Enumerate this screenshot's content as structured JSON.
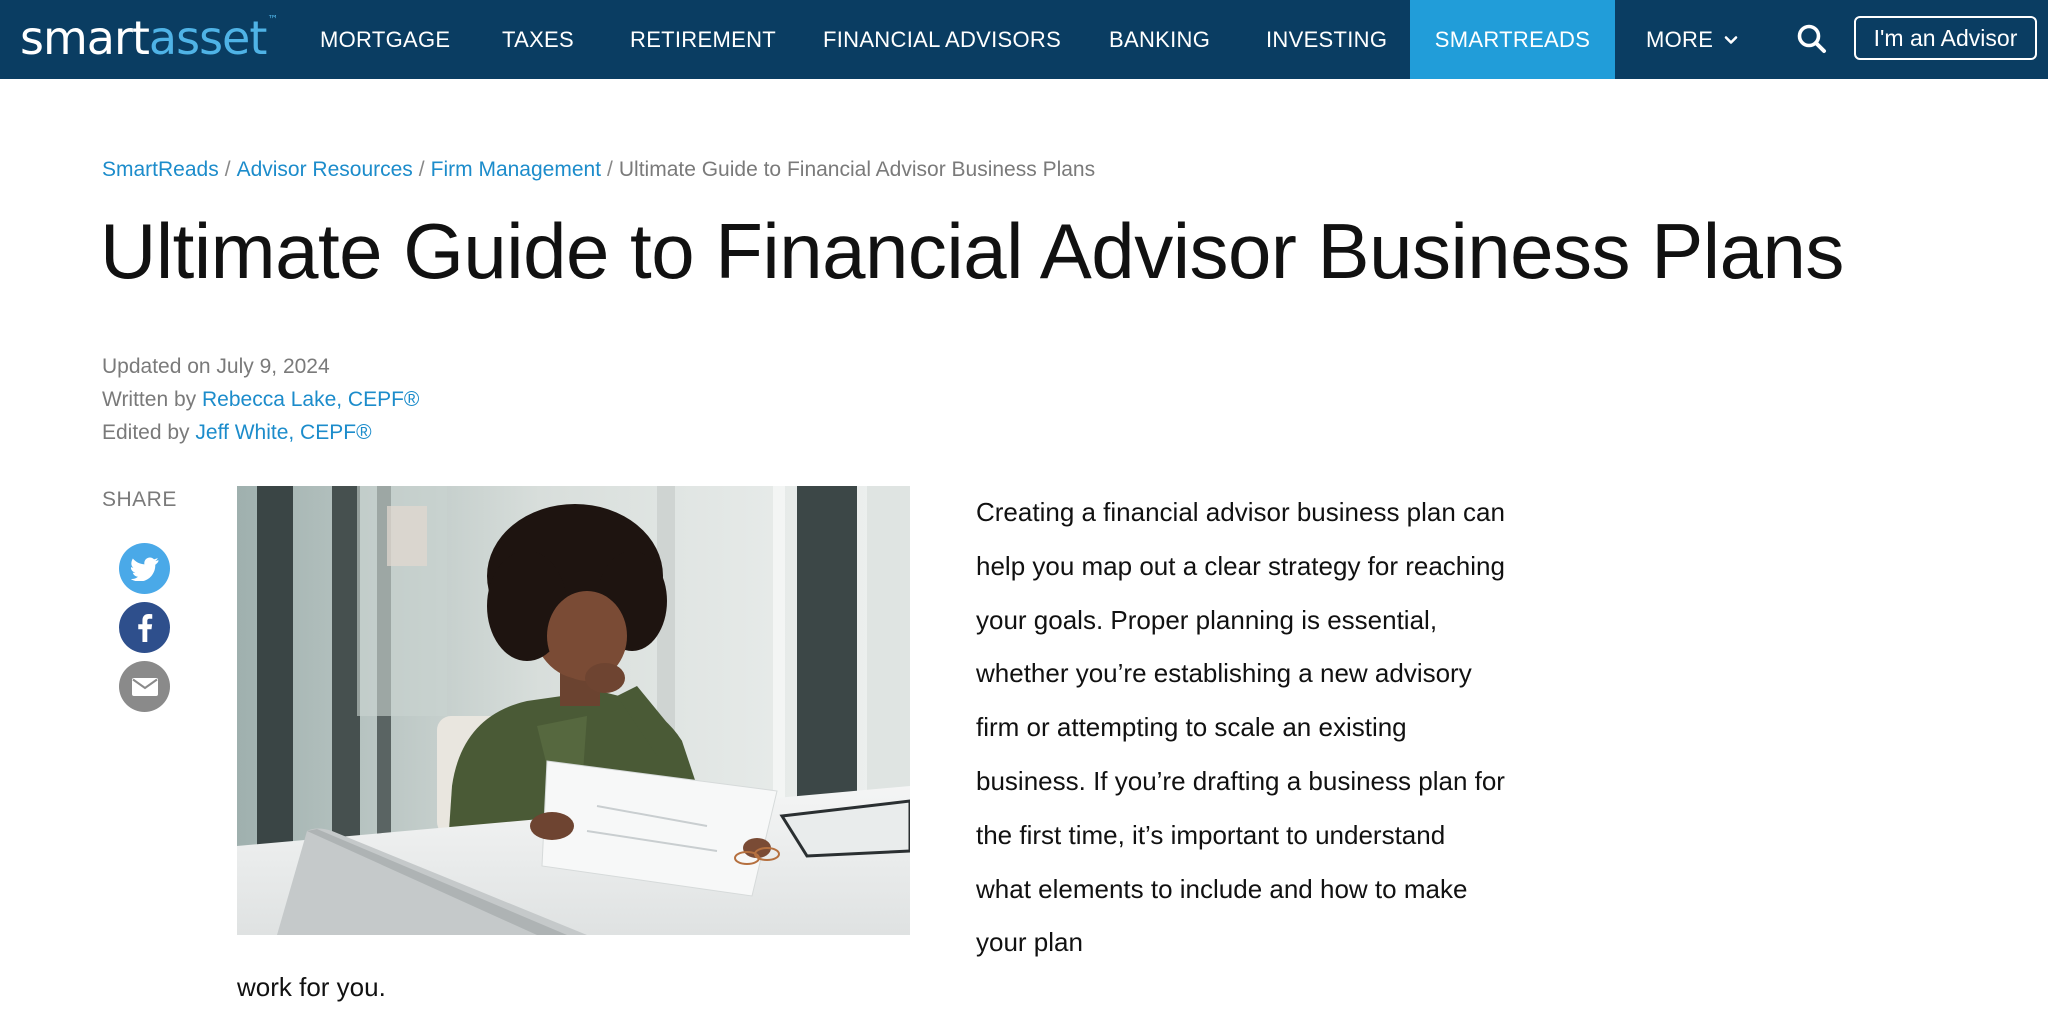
{
  "nav": {
    "logo_smart": "smart",
    "logo_asset": "asset",
    "logo_tm": "™",
    "items": [
      {
        "label": "MORTGAGE"
      },
      {
        "label": "TAXES"
      },
      {
        "label": "RETIREMENT"
      },
      {
        "label": "FINANCIAL ADVISORS"
      },
      {
        "label": "BANKING"
      },
      {
        "label": "INVESTING"
      },
      {
        "label": "SMARTREADS",
        "active": true
      },
      {
        "label": "MORE"
      }
    ],
    "search_icon": "search-icon",
    "advisor_button": "I'm an Advisor",
    "colors": {
      "bar": "#0a3d62",
      "active": "#219dd9",
      "logo_accent": "#4fb3e6"
    }
  },
  "breadcrumb": {
    "items": [
      "SmartReads",
      "Advisor Resources",
      "Firm Management"
    ],
    "separator": "/",
    "current": "Ultimate Guide to Financial Advisor Business Plans"
  },
  "article": {
    "title": "Ultimate Guide to Financial Advisor Business Plans",
    "updated": "Updated on July 9, 2024",
    "written_by_label": "Written by",
    "author": "Rebecca Lake, CEPF®",
    "edited_by_label": "Edited by",
    "editor": "Jeff White, CEPF®",
    "share_label": "SHARE",
    "share_icons": [
      "twitter-icon",
      "facebook-icon",
      "email-icon"
    ],
    "intro": "Creating a financial advisor business plan can help you map out a clear strategy for reaching your goals. Proper planning is essential, whether you’re establishing a new advisory firm or attempting to scale an existing business. If you’re drafting a business plan for the first time, it’s important to understand what elements to include and how to make your plan",
    "intro_tail": "work for you.",
    "link_color": "#1c8ccb"
  }
}
